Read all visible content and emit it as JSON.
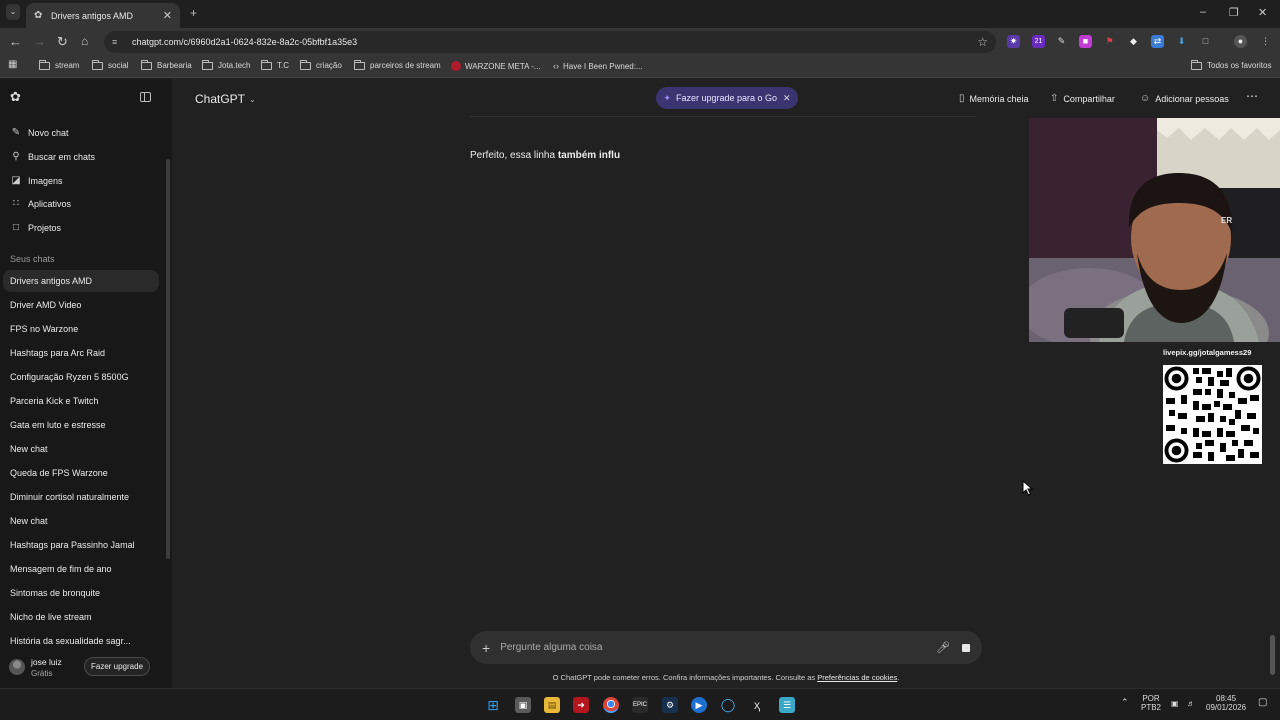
{
  "browser": {
    "tab_title": "Drivers antigos AMD",
    "url": "chatgpt.com/c/6960d2a1-0624-832e-8a2c-05bfbf1a35e3",
    "bookmarks": [
      "stream",
      "social",
      "Barbearia",
      "Jota.tech",
      "T.C",
      "criação",
      "parceiros de stream",
      "WARZONE META -...",
      "Have I Been Pwned:..."
    ],
    "all_bookmarks": "Todos os favoritos",
    "extension_badge": "21"
  },
  "sidebar": {
    "nav": [
      {
        "label": "Novo chat",
        "icon": "new-chat-icon"
      },
      {
        "label": "Buscar em chats",
        "icon": "search-icon"
      },
      {
        "label": "Imagens",
        "icon": "images-icon"
      },
      {
        "label": "Aplicativos",
        "icon": "apps-icon"
      },
      {
        "label": "Projetos",
        "icon": "folder-icon"
      }
    ],
    "section_title": "Seus chats",
    "chats": [
      "Drivers antigos AMD",
      "Driver AMD Video",
      "FPS no Warzone",
      "Hashtags para Arc Raid",
      "Configuração Ryzen 5 8500G",
      "Parceria Kick e Twitch",
      "Gata em luto e estresse",
      "New chat",
      "Queda de FPS Warzone",
      "Diminuir cortisol naturalmente",
      "New chat",
      "Hashtags para Passinho Jamal",
      "Mensagem de fim de ano",
      "Sintomas de bronquite",
      "Nicho de live stream",
      "História da sexualidade sagr..."
    ],
    "user": {
      "name": "jose luiz",
      "plan": "Grátis"
    },
    "upgrade_label": "Fazer upgrade"
  },
  "header": {
    "model": "ChatGPT",
    "upgrade_pill": "Fazer upgrade para o Go",
    "memory": "Memória cheia",
    "share": "Compartilhar",
    "add_people": "Adicionar pessoas"
  },
  "conversation": {
    "message_plain": "Perfeito, essa linha ",
    "message_bold": "também influ"
  },
  "composer": {
    "placeholder": "Pergunte alguma coisa",
    "disclaimer": "O ChatGPT pode cometer erros. Confira informações importantes. Consulte as ",
    "disclaimer_link": "Preferências de cookies",
    "disclaimer_end": "."
  },
  "overlay": {
    "livepix": "livepix.gg/jotalgamess29",
    "webcam_text": "ER"
  },
  "taskbar": {
    "language_1": "POR",
    "language_2": "PTB2",
    "time": "08:45",
    "date": "09/01/2026",
    "epic_label": "EPIC"
  },
  "colors": {
    "accent_pill": "#3a3470",
    "sidebar_bg": "#181818",
    "main_bg": "#212121"
  }
}
